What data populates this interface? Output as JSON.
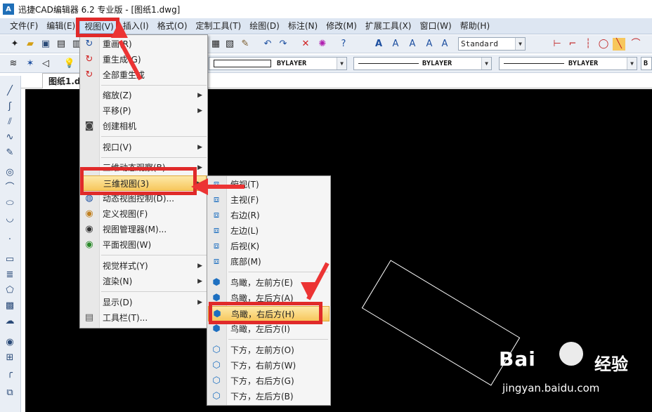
{
  "window": {
    "app_icon": "cad-app-icon",
    "title": "迅捷CAD编辑器 6.2 专业版  - [图纸1.dwg]"
  },
  "menubar": [
    {
      "label": "文件(F)"
    },
    {
      "label": "编辑(E)"
    },
    {
      "label": "视图(V)"
    },
    {
      "label": "插入(I)"
    },
    {
      "label": "格式(O)"
    },
    {
      "label": "定制工具(T)"
    },
    {
      "label": "绘图(D)"
    },
    {
      "label": "标注(N)"
    },
    {
      "label": "修改(M)"
    },
    {
      "label": "扩展工具(X)"
    },
    {
      "label": "窗口(W)"
    },
    {
      "label": "帮助(H)"
    }
  ],
  "toolbar": {
    "text_style_combo": "Standard",
    "color_combo": "BYLAYER",
    "linetype_combo": "BYLAYER",
    "lineweight_combo": "BYLAYER",
    "right_combo": "B"
  },
  "document_tab": "图纸1.dwg",
  "view_menu": {
    "items": [
      {
        "label": "重画(R)",
        "icon": "redraw-icon"
      },
      {
        "label": "重生成(G)",
        "icon": "regen-icon"
      },
      {
        "label": "全部重生成",
        "icon": "regen-all-icon"
      },
      {
        "label": "缩放(Z)",
        "submenu": true
      },
      {
        "label": "平移(P)",
        "submenu": true
      },
      {
        "label": "创建相机",
        "icon": "camera-icon"
      },
      {
        "label": "视口(V)",
        "submenu": true
      },
      {
        "label": "三维动态观察(B)",
        "submenu": true
      },
      {
        "label": "三维视图(3)",
        "submenu": true
      },
      {
        "label": "动态视图控制(D)...",
        "icon": "dynamic-view-icon"
      },
      {
        "label": "定义视图(F)",
        "icon": "define-view-icon"
      },
      {
        "label": "视图管理器(M)...",
        "icon": "view-manager-icon"
      },
      {
        "label": "平面视图(W)",
        "icon": "plan-view-icon"
      },
      {
        "label": "视觉样式(Y)",
        "submenu": true
      },
      {
        "label": "渲染(N)",
        "submenu": true
      },
      {
        "label": "显示(D)",
        "submenu": true
      },
      {
        "label": "工具栏(T)...",
        "icon": "toolbar-icon"
      }
    ]
  },
  "view3d_menu": {
    "items": [
      {
        "label": "俯视(T)"
      },
      {
        "label": "主视(F)"
      },
      {
        "label": "右边(R)"
      },
      {
        "label": "左边(L)"
      },
      {
        "label": "后视(K)"
      },
      {
        "label": "底部(M)"
      },
      {
        "label": "鸟瞰，左前方(E)"
      },
      {
        "label": "鸟瞰，左后方(A)"
      },
      {
        "label": "鸟瞰，右后方(H)"
      },
      {
        "label": "鸟瞰，左后方(I)"
      },
      {
        "label": "下方，左前方(O)"
      },
      {
        "label": "下方，右前方(W)"
      },
      {
        "label": "下方，右后方(G)"
      },
      {
        "label": "下方，左后方(B)"
      }
    ]
  },
  "watermark": {
    "brand_left": "Bai",
    "brand_right": "经验",
    "url": "jingyan.baidu.com"
  },
  "colors": {
    "annotation": "#e02a2a",
    "highlight": "#f7c75c",
    "canvas": "#000000"
  }
}
